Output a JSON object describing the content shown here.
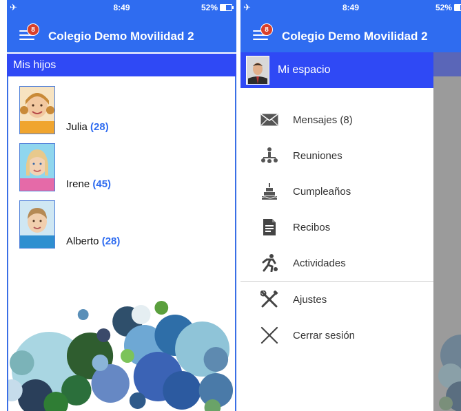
{
  "status": {
    "time": "8:49",
    "battery_label": "52%",
    "battery_level": 0.52
  },
  "app": {
    "title": "Colegio Demo Movilidad 2",
    "menu_badge": "8"
  },
  "left": {
    "section_title": "Mis hijos",
    "children": [
      {
        "name": "Julia",
        "count": "(28)",
        "icon": "girl-photo"
      },
      {
        "name": "Irene",
        "count": "(45)",
        "icon": "girl-photo"
      },
      {
        "name": "Alberto",
        "count": "(28)",
        "icon": "boy-photo"
      }
    ]
  },
  "drawer": {
    "header_title": "Mi espacio",
    "items": [
      {
        "label": "Mensajes (8)",
        "icon": "envelope-icon"
      },
      {
        "label": "Reuniones",
        "icon": "meeting-icon"
      },
      {
        "label": "Cumpleaños",
        "icon": "cake-icon"
      },
      {
        "label": "Recibos",
        "icon": "receipt-icon"
      },
      {
        "label": "Actividades",
        "icon": "activity-icon"
      },
      {
        "label": "Ajustes",
        "icon": "tools-icon"
      },
      {
        "label": "Cerrar sesión",
        "icon": "close-icon"
      }
    ]
  },
  "colors": {
    "primary": "#2f6cf0",
    "header": "#2f49f5",
    "badge": "#d9402b",
    "count": "#2f6cf0"
  }
}
